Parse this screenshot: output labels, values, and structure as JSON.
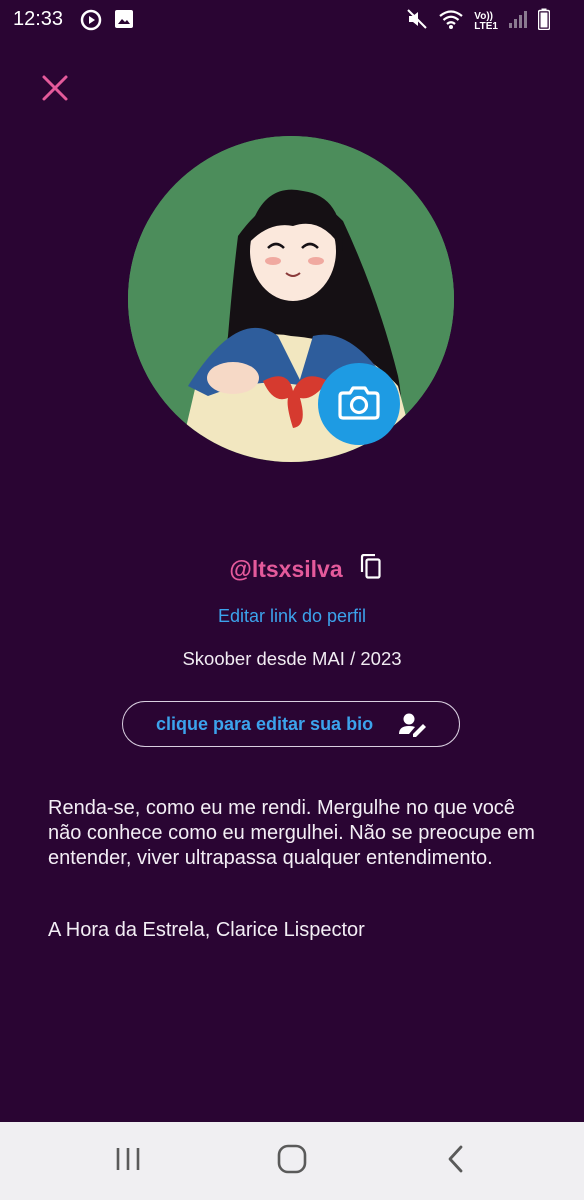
{
  "status_bar": {
    "time": "12:33",
    "left_icons": [
      "media-play-icon",
      "image-icon"
    ],
    "right_icons": [
      "mute-icon",
      "wifi-icon",
      "volte-icon",
      "signal-icon",
      "battery-icon"
    ],
    "volte_label_top": "Vo))",
    "volte_label_bottom": "LTE1"
  },
  "header": {
    "close_icon": "close-icon"
  },
  "profile": {
    "avatar_alt": "profile-picture",
    "camera_icon": "camera-icon",
    "username": "@ltsxsilva",
    "copy_icon": "copy-icon",
    "edit_link_label": "Editar link do perfil",
    "member_since": "Skoober desde MAI / 2023",
    "bio_edit_label": "clique para editar sua bio",
    "bio_edit_icon": "user-edit-icon"
  },
  "bio": {
    "text": "Renda-se, como eu me rendi. Mergulhe no que você não conhece como eu mergulhei. Não se preocupe em entender, viver ultrapassa qualquer entendimento.",
    "attribution": "A Hora da Estrela, Clarice Lispector"
  },
  "nav_bar": {
    "recents_icon": "recents-icon",
    "home_icon": "home-icon",
    "back_icon": "back-icon"
  },
  "colors": {
    "background": "#2a0533",
    "accent_pink": "#e45a9b",
    "accent_blue": "#3ca3ec",
    "camera_blue": "#1e9be3"
  }
}
